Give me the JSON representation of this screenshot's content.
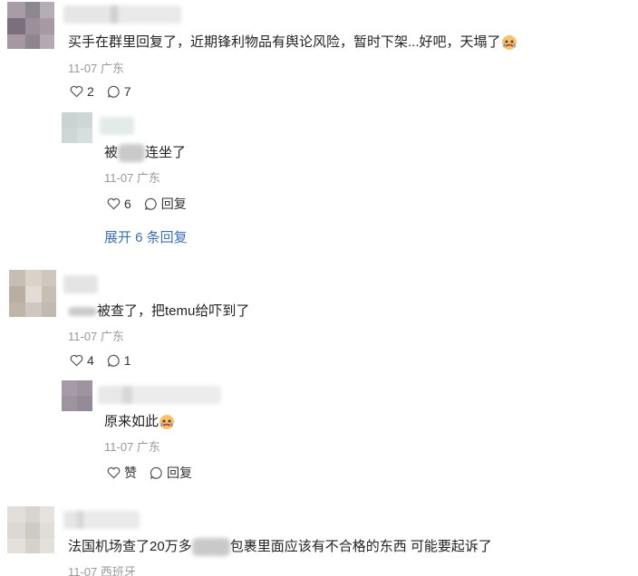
{
  "comments": [
    {
      "text_a": "买手在群里回复了，近期锋利物品有舆论风险，暂时下架...好吧，天塌了",
      "emoji": "crying-face-icon",
      "date": "11-07",
      "location": "广东",
      "likes": "2",
      "replies_count": "7",
      "reply": {
        "text_a": "被",
        "text_b": "连坐了",
        "date": "11-07",
        "location": "广东",
        "likes": "6",
        "reply_label": "回复"
      },
      "expand_label": "展开 6 条回复"
    },
    {
      "text_b": "被查了，把temu给吓到了",
      "date": "11-07",
      "location": "广东",
      "likes": "4",
      "replies_count": "1",
      "reply": {
        "text_a": "原来如此",
        "emoji": "crying-face-icon",
        "date": "11-07",
        "location": "广东",
        "like_label": "赞",
        "reply_label": "回复"
      }
    },
    {
      "text_a": "法国机场查了20万多",
      "text_b": "包裹里面应该有不合格的东西 可能要起诉了",
      "date": "11-07",
      "location": "西班牙"
    }
  ],
  "colors": {
    "link": "#3d6fb3",
    "meta": "#999999"
  }
}
